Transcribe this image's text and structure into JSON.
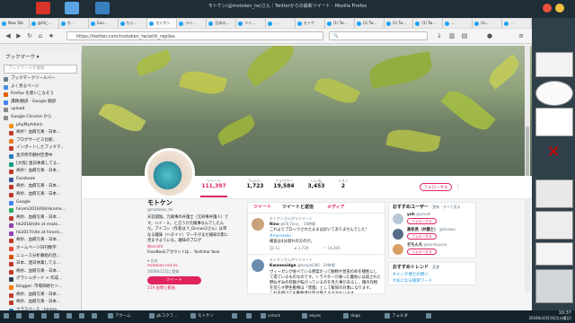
{
  "window_title": "モトケン(@motoken_tw)さん｜Twitterからの最新ツイート - Mozilla Firefox",
  "tabs": [
    {
      "label": "New Tab"
    },
    {
      "label": "@AIに…"
    },
    {
      "label": "ち…"
    },
    {
      "label": "Goo…"
    },
    {
      "label": "ちら…"
    },
    {
      "label": "モトケン"
    },
    {
      "label": "ライ…"
    },
    {
      "label": "日本の…"
    },
    {
      "label": "ツイ…"
    },
    {
      "label": "…"
    },
    {
      "label": "モトケ"
    },
    {
      "label": "(1) Tw…"
    },
    {
      "label": "(1) Tw…"
    },
    {
      "label": "(1) Tw…"
    },
    {
      "label": "(1) Tw…"
    },
    {
      "label": "…"
    },
    {
      "label": "Un…"
    },
    {
      "label": "…"
    }
  ],
  "url": "https://twitter.com/motoken_tw/with_replies",
  "search_placeholder": "",
  "sidebar": {
    "title": "ブックマーク ▾",
    "search_placeholder": "ブックマークを検索",
    "items": [
      {
        "label": "ブックマークツールバー",
        "color": "#6b7f8a"
      },
      {
        "label": "よく見るページ",
        "color": "#4a8fe0"
      },
      {
        "label": "Firefox を使いこなそう",
        "color": "#e66000"
      },
      {
        "label": "課題/翻訳 - Google 翻訳",
        "color": "#4285f4"
      },
      {
        "label": "upload",
        "color": "#8a8a8a"
      },
      {
        "label": "Google Chrome から",
        "color": "#8a8a8a"
      },
      {
        "label": "phpMyAdmin",
        "color": "#f29111"
      },
      {
        "label": "奇妙！血痕写真 - 日本…",
        "color": "#c0392b"
      },
      {
        "label": "ブログサービス比較…",
        "color": "#e67e22"
      },
      {
        "label": "インポートしたブックマ…",
        "color": "#c0392b"
      },
      {
        "label": "金沢県市郷村空港中",
        "color": "#2980b9"
      },
      {
        "label": "[大阪] 連日休業してる…",
        "color": "#16a085"
      },
      {
        "label": "奇妙！血痕写真 - 日本…",
        "color": "#c0392b"
      },
      {
        "label": "Facebook",
        "color": "#3b5998"
      },
      {
        "label": "奇妙、血痕写真 - 日本…",
        "color": "#c0392b"
      },
      {
        "label": "奇妙、血痕写真 - 日本…",
        "color": "#c0392b"
      },
      {
        "label": "Google",
        "color": "#4285f4"
      },
      {
        "label": "hiromi2016/06/Hirome…",
        "color": "#27ae60"
      },
      {
        "label": "奇妙、血痕写真 - 日本…",
        "color": "#c0392b"
      },
      {
        "label": "hk2018/site at mozo…",
        "color": "#8e44ad"
      },
      {
        "label": "hk2017/site at hiromi…",
        "color": "#8e44ad"
      },
      {
        "label": "奇妙、血痕写真 - 日本…",
        "color": "#c0392b"
      },
      {
        "label": "ホームページ日刊数字",
        "color": "#e74c3c"
      },
      {
        "label": "ニュース分析番組の話…",
        "color": "#d35400"
      },
      {
        "label": "日本、連日休業してる…",
        "color": "#c0392b"
      },
      {
        "label": "奇妙、血痕写真 - 日本…",
        "color": "#c0392b"
      },
      {
        "label": "グラシュボード < 作成…",
        "color": "#2c3e50"
      },
      {
        "label": "blogger: 市場価格セン…",
        "color": "#f57d00"
      },
      {
        "label": "奇妙、血痕写真 - 日本…",
        "color": "#c0392b"
      },
      {
        "label": "奇妙、血痕写真 - 日本…",
        "color": "#c0392b"
      },
      {
        "label": "クラスペース - hirono…",
        "color": "#2980b9"
      },
      {
        "label": "金沢市郷市郷村空港",
        "color": "#2980b9"
      },
      {
        "label": "blogger: 市場価格セン…",
        "color": "#f57d00"
      }
    ]
  },
  "twitter_nav": {
    "home": "ホーム",
    "moments": "モーメント",
    "notifications": "通知",
    "messages": "メッセージ",
    "search_placeholder": "キーワード検索",
    "tweet_button": "ツイート"
  },
  "stats": [
    {
      "label": "ツイート",
      "value": "111,397"
    },
    {
      "label": "フォロー",
      "value": "1,723"
    },
    {
      "label": "フォロワー",
      "value": "19,584"
    },
    {
      "label": "いいね",
      "value": "3,453"
    },
    {
      "label": "リスト",
      "value": "2"
    }
  ],
  "follow_label": "フォローする",
  "profile": {
    "name": "モトケン",
    "handle": "@motoken_tw",
    "bio": "天涯孤独。元検事の弁護士（元刑事弁護人）です。ハイ・ミ。と言うか元検事なんでしたんだ。アイコン（作者は Y_Ginnan2さん）は単なる趣味（ヘタイイ）マーチがまだ検知の影に見ますようにな。趣味のブログ",
    "link_text": "Nescafe",
    "extra": "FaceBookアカウントは… Yoshimo Yase",
    "location": "日本",
    "blog": "motoken.net.ex",
    "joined": "2009年12月に登録",
    "tweet_to": "ツイート",
    "media_link": "219 画像と動画"
  },
  "timeline_tabs": [
    "ツイート",
    "ツイートと返信",
    "メディア"
  ],
  "tweets": [
    {
      "retweet_note": "モトケンさんがリツイート",
      "author": "Rino",
      "handle": "@00_Rino_ · 10時間",
      "text": "これよりブロックされたままは好いてありませんでした！",
      "hashtag": "#moraneki",
      "text2": "検査は4分遅れの方のが。",
      "replies": "11",
      "retweets": "2,729",
      "likes": "14,285",
      "avatar_color": "#c9a27a"
    },
    {
      "retweet_note": "モトケンさんがリツイート",
      "author": "Kwanexidge",
      "handle": "@kanjad280 · 24時間",
      "text": "ヴィーガンが食べている野菜だって動物や昆虫の命を犠牲にして得ているものなのです。トラクターが通った農地には殺された野ねずみの死骸が転がっているのを見た事があるし、畑の作物を荒らす野生動物は「害獣」として駆除の対象になります。",
      "text2": "これを続けても動物達は皆は救えますかないます。",
      "replies": "",
      "retweets": "",
      "likes": "",
      "avatar_color": "#6a8caf"
    }
  ],
  "who_to_follow": {
    "title": "おすすめユーザー",
    "sub": "· 更新 · すべて見る",
    "users": [
      {
        "name": "yoh",
        "handle": "@yeaoh",
        "avatar_color": "#b7c7d6"
      },
      {
        "name": "高校長（弁護士）",
        "handle": "@hikawa",
        "avatar_color": "#556a86"
      },
      {
        "name": "ぢちんち",
        "handle": "@sanhayuna",
        "avatar_color": "#d9a066"
      }
    ],
    "follow_label": "フォローする"
  },
  "trends": {
    "title": "おすすめトレンド",
    "sub": "· 変更",
    "items": [
      "#メンタ博士の問い",
      "#気になる検索ワード"
    ]
  },
  "taskbar": {
    "items": [
      "アクーム",
      "gkコクフ…",
      "モトケン",
      "",
      "",
      "xclock",
      "xeyes",
      "dogo",
      "フォルダ",
      ""
    ],
    "clock_time": "10:37",
    "clock_date": "2018年10月16日(火曜日)"
  }
}
